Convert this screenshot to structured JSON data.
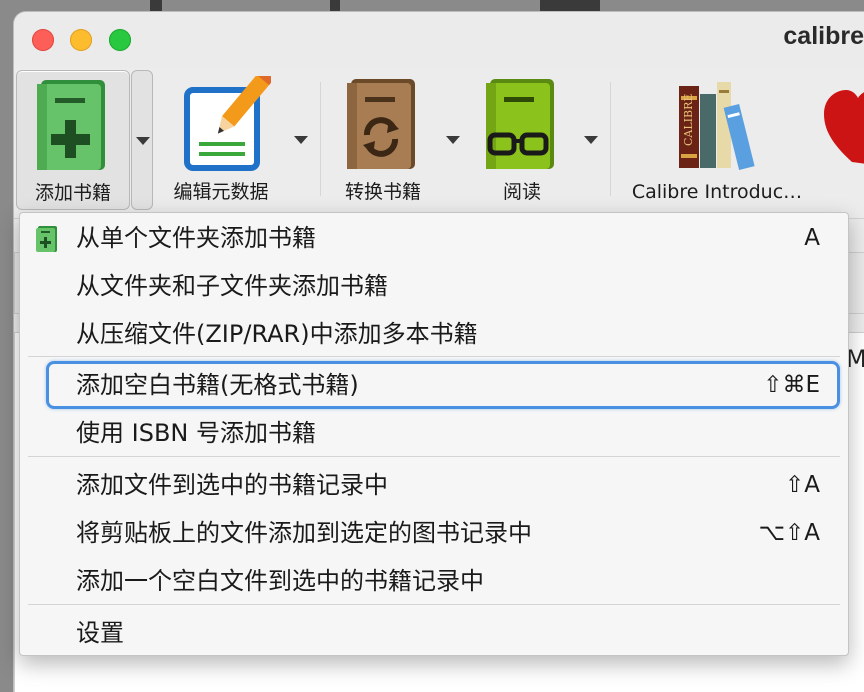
{
  "window": {
    "title": "calibre"
  },
  "toolbar": {
    "buttons": [
      {
        "label": "添加书籍",
        "icon": "add-book-icon"
      },
      {
        "label": "编辑元数据",
        "icon": "edit-metadata-icon"
      },
      {
        "label": "转换书籍",
        "icon": "convert-books-icon"
      },
      {
        "label": "阅读",
        "icon": "view-book-icon"
      },
      {
        "label": "Calibre Introduc…",
        "icon": "calibre-introduction-icon"
      }
    ]
  },
  "menu": {
    "items": [
      {
        "label": "从单个文件夹添加书籍",
        "shortcut": "A",
        "icon": "add-book-small-icon"
      },
      {
        "label": "从文件夹和子文件夹添加书籍",
        "shortcut": ""
      },
      {
        "label": "从压缩文件(ZIP/RAR)中添加多本书籍",
        "shortcut": ""
      },
      {
        "label": "添加空白书籍(无格式书籍)",
        "shortcut": "⇧⌘E",
        "focused": true
      },
      {
        "label": "使用 ISBN 号添加书籍",
        "shortcut": ""
      },
      {
        "label": "添加文件到选中的书籍记录中",
        "shortcut": "⇧A"
      },
      {
        "label": "将剪贴板上的文件添加到选定的图书记录中",
        "shortcut": "⌥⇧A"
      },
      {
        "label": "添加一个空白文件到选中的书籍记录中",
        "shortcut": ""
      },
      {
        "label": "设置",
        "shortcut": ""
      }
    ]
  },
  "background": {
    "partial_letter": "M"
  },
  "colors": {
    "focus": "#4a90e2",
    "add_green": "#3aa83a",
    "edit_blue": "#1f72c8"
  }
}
